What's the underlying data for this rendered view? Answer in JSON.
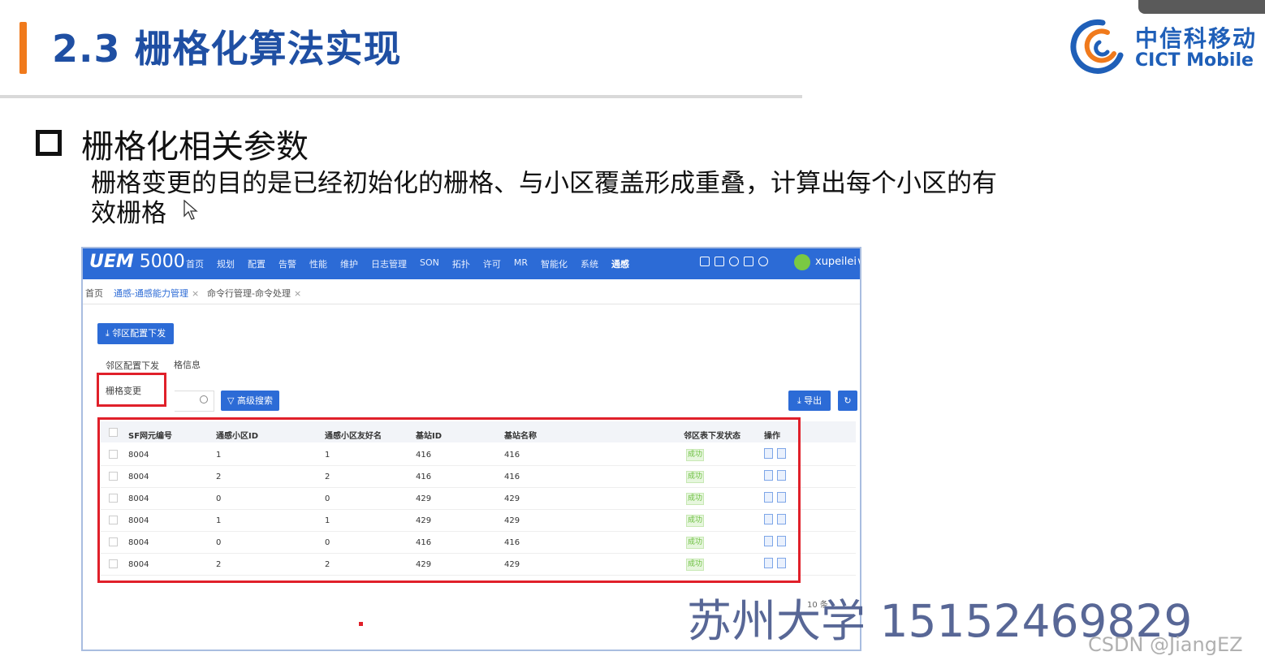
{
  "slide": {
    "title": "2.3 栅格化算法实现",
    "section_heading": "栅格化相关参数",
    "description": "栅格变更的目的是已经初始化的栅格、与小区覆盖形成重叠，计算出每个小区的有效栅格"
  },
  "logo": {
    "chinese": "中信科移动",
    "english": "CICT Mobile",
    "colors": {
      "blue": "#1f5fb8",
      "orange": "#f07a1c"
    }
  },
  "app": {
    "brand_prefix": "UEM",
    "brand_number": "5000",
    "nav": [
      "首页",
      "规划",
      "配置",
      "告警",
      "性能",
      "维护",
      "日志管理",
      "SON",
      "拓扑",
      "许可",
      "MR",
      "智能化",
      "系统",
      "通感"
    ],
    "active_nav": "通感",
    "user": "xupeilei",
    "user_chevron": "∨",
    "tabs": [
      {
        "label": "首页"
      },
      {
        "label": "通感-通感能力管理",
        "close": "×"
      },
      {
        "label": "命令行管理-命令处理",
        "close": "×"
      }
    ],
    "primary_action": "邻区配置下发",
    "dropdown": [
      "邻区配置下发",
      "栅格变更"
    ],
    "grid_tab_label": "格信息",
    "advanced_search": "高级搜索",
    "export": "导出",
    "table": {
      "columns": [
        "SF网元编号",
        "通感小区ID",
        "通感小区友好名",
        "基站ID",
        "基站名称",
        "邻区表下发状态",
        "操作"
      ],
      "rows": [
        [
          "8004",
          "1",
          "1",
          "416",
          "416",
          "成功"
        ],
        [
          "8004",
          "2",
          "2",
          "416",
          "416",
          "成功"
        ],
        [
          "8004",
          "0",
          "0",
          "429",
          "429",
          "成功"
        ],
        [
          "8004",
          "1",
          "1",
          "429",
          "429",
          "成功"
        ],
        [
          "8004",
          "0",
          "0",
          "416",
          "416",
          "成功"
        ],
        [
          "8004",
          "2",
          "2",
          "429",
          "429",
          "成功"
        ]
      ]
    },
    "page_size": "10 条"
  },
  "watermark": {
    "overlay": "苏州大学 15152469829",
    "credit": "CSDN @JiangEZ"
  },
  "colors": {
    "title_blue": "#1f4fa3",
    "nav_blue": "#2c6bd6",
    "highlight_red": "#e0202a"
  }
}
